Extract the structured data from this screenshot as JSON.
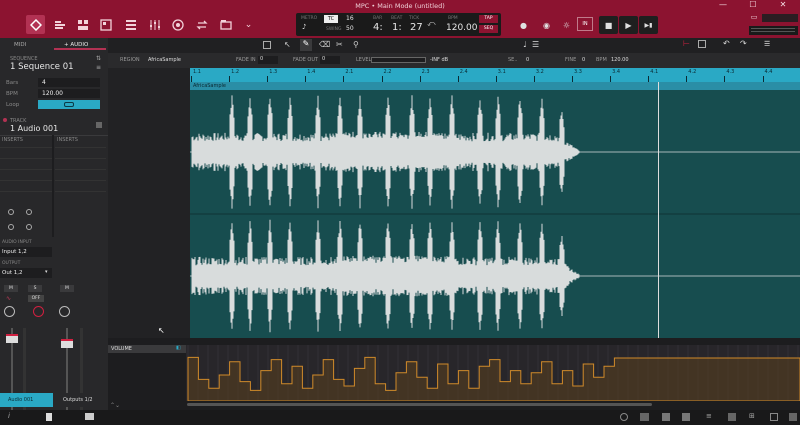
{
  "window": {
    "title": "MPC • Main Mode (untitled)",
    "min": "—",
    "max": "☐",
    "close": "✕"
  },
  "toolbar": {
    "icons": [
      "main-mode-icon",
      "track-view-icon",
      "grid-view-icon",
      "pad-mode-icon",
      "mixer-icon",
      "record-icon",
      "loop-icon",
      "more-icon"
    ]
  },
  "transport": {
    "metro_label": "METRO",
    "tc_label": "TC",
    "tc_value": "16",
    "swing_label": "SWING",
    "swing_value": "50",
    "bar_label": "BAR",
    "bar_value": "4:",
    "beat_label": "BEAT",
    "beat_value": "1:",
    "tick_label": "TICK",
    "tick_value": "27",
    "bpm_label": "BPM",
    "bpm_value": "120.00",
    "tap_label": "TAP",
    "seq_label": "SEQ"
  },
  "play_controls": {
    "rec": "●",
    "overdub": "◉",
    "auto": "☼",
    "in_label": "IN",
    "stop": "■",
    "play": "▶",
    "play_start": "▶▮"
  },
  "left": {
    "tab_midi": "MIDI",
    "tab_audio": "+ AUDIO",
    "sequence_label": "SEQUENCE",
    "sequence_name": "1 Sequence 01",
    "bars_label": "Bars",
    "bars_value": "4",
    "bpm_label": "BPM",
    "bpm_value": "120.00",
    "loop_label": "Loop",
    "track_label": "TRACK",
    "track_name": "1 Audio 001",
    "inserts_label": "INSERTS",
    "audio_input_label": "AUDIO INPUT",
    "audio_input_value": "Input 1,2",
    "output_label": "OUTPUT",
    "output_value": "Out 1,2",
    "m_label": "M",
    "s_label": "S",
    "off_label": "OFF",
    "tab_audio001": "Audio 001",
    "tab_outputs": "Outputs 1/2"
  },
  "infobar": {
    "region_label": "REGION",
    "region_value": "AfricaSample",
    "fadein_label": "FADE IN",
    "fadein_value": "0",
    "fadeout_label": "FADE OUT",
    "fadeout_value": "0",
    "level_label": "LEVEL",
    "inf_label": "-INF dB",
    "semi_label": "SE..",
    "semi_value": "0",
    "fine_label": "FINE",
    "fine_value": "0",
    "bpm_label": "BPM",
    "bpm_value": "120.00"
  },
  "ruler": {
    "ticks": [
      "1.1",
      "1.2",
      "1.3",
      "1.4",
      "2.1",
      "2.2",
      "2.3",
      "2.4",
      "3.1",
      "3.2",
      "3.3",
      "3.4",
      "4.1",
      "4.2",
      "4.3",
      "4.4"
    ]
  },
  "clip": {
    "name": "AfricaSample"
  },
  "automation": {
    "label": "VOLUME"
  },
  "colors": {
    "accent": "#8c1330",
    "cyan": "#2aa9c5",
    "wave_bg": "#174d4f",
    "env": "#d08a2a"
  }
}
